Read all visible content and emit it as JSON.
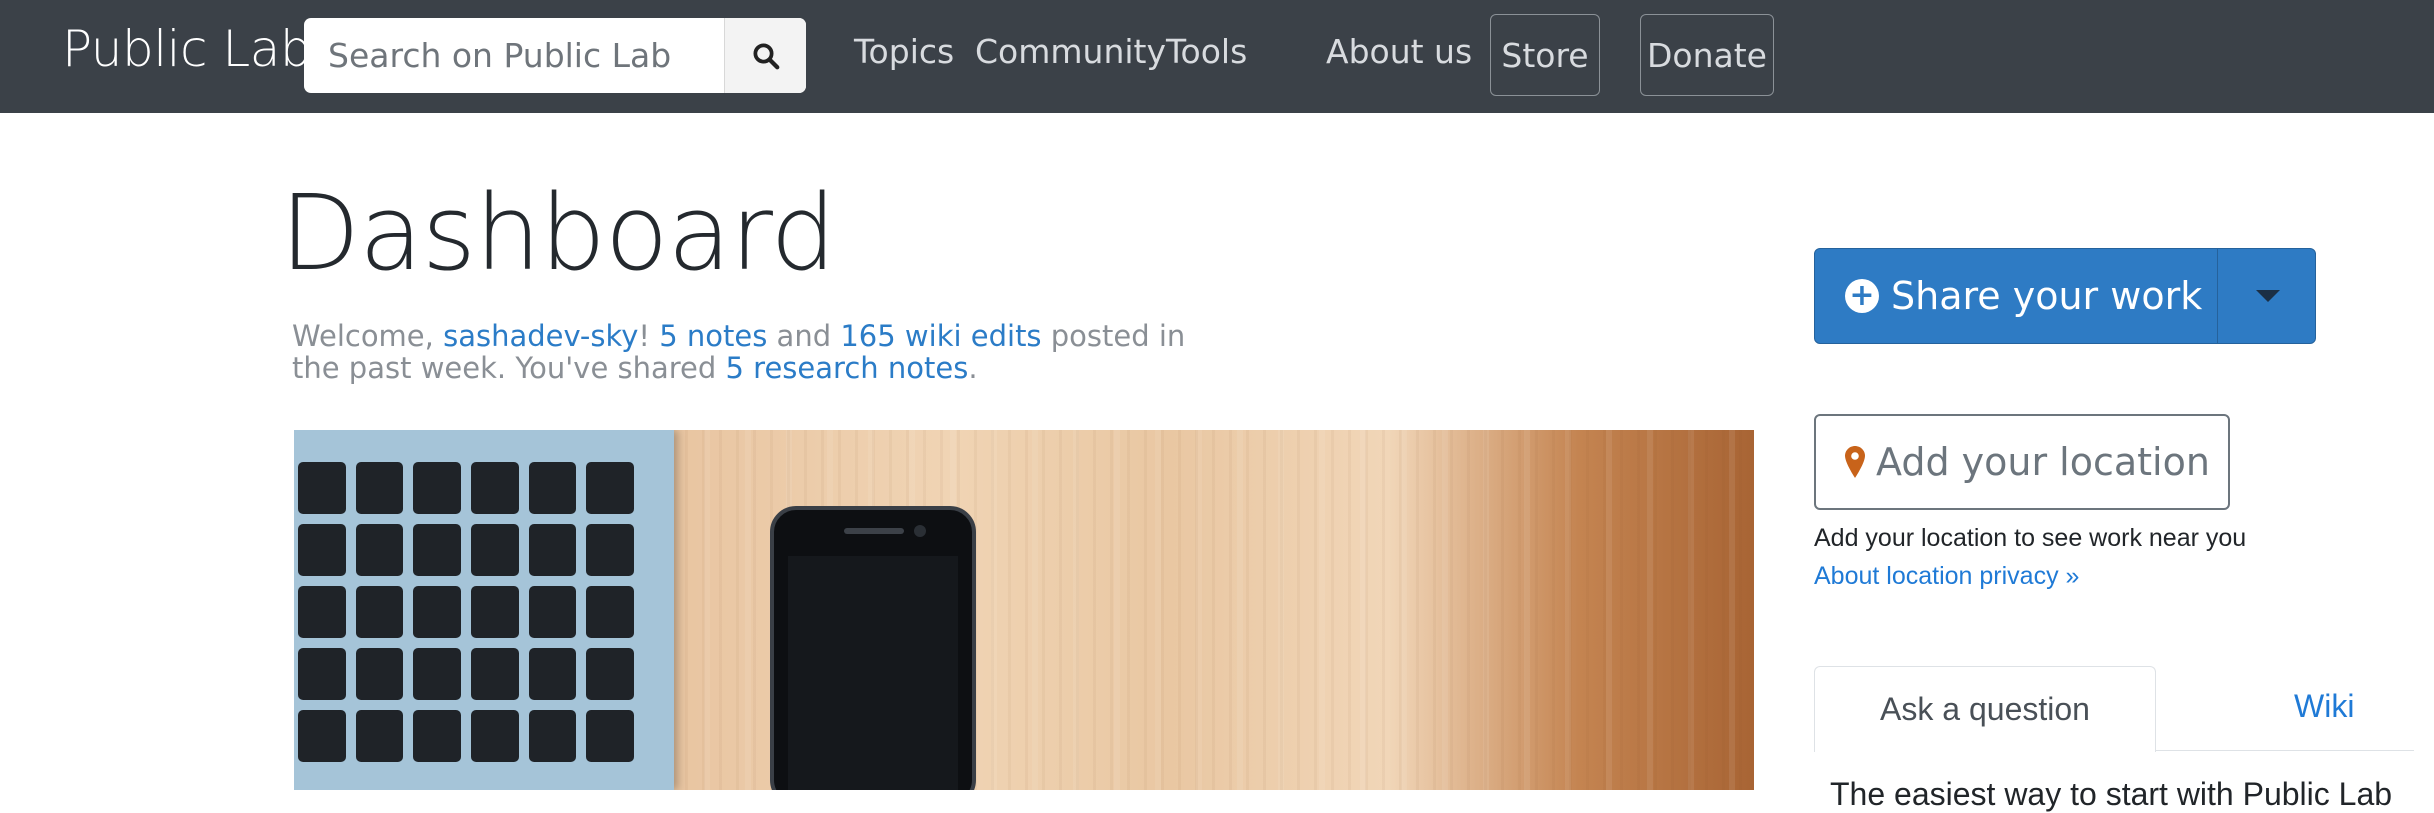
{
  "navbar": {
    "brand": "Public Lab",
    "search_placeholder": "Search on Public Lab",
    "links": [
      "Topics",
      "Community",
      "Tools",
      "About us"
    ],
    "store_label": "Store",
    "donate_label": "Donate"
  },
  "main": {
    "title": "Dashboard",
    "welcome": {
      "prefix": "Welcome, ",
      "username": "sashadev-sky",
      "sep": "! ",
      "notes": "5 notes",
      "and": " and ",
      "wiki_edits": "165 wiki edits",
      "middle": " posted in the past week. You've shared ",
      "research": "5 research notes",
      "end": "."
    }
  },
  "sidebar": {
    "share_label": "Share your work",
    "location_label": "Add your location",
    "location_help": "Add your location to see work near you",
    "location_privacy": "About location privacy »",
    "tabs": [
      "Ask a question",
      "Wiki"
    ],
    "tab_content": "The easiest way to start with Public Lab"
  },
  "colors": {
    "navbar_bg": "#3b4148",
    "link": "#2b7cc7",
    "primary": "#2e7bc4",
    "location_pin": "#c8631a"
  }
}
